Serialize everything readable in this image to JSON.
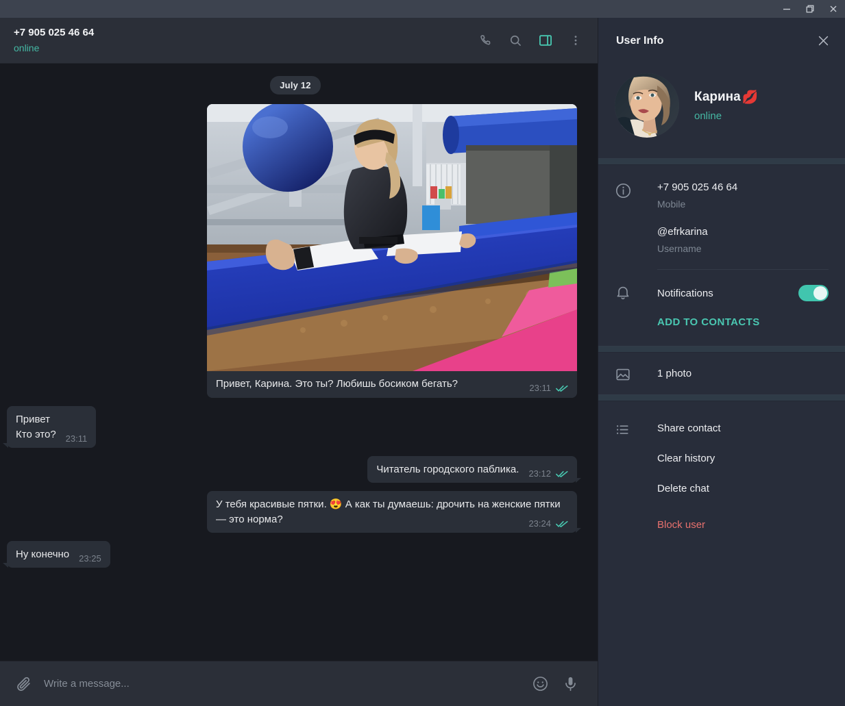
{
  "window": {
    "controls": [
      {
        "name": "minimize",
        "label": "Minimize"
      },
      {
        "name": "restore",
        "label": "Restore"
      },
      {
        "name": "close",
        "label": "Close"
      }
    ]
  },
  "chat_header": {
    "name": "+7 905 025 46 64",
    "status": "online",
    "actions": [
      {
        "icon": "phone-icon",
        "label": "Call"
      },
      {
        "icon": "search-icon",
        "label": "Search"
      },
      {
        "icon": "info-panel-toggle-icon",
        "label": "Toggle info panel",
        "active": true
      },
      {
        "icon": "more-vertical-icon",
        "label": "More"
      }
    ]
  },
  "conversation": {
    "date_separator": "July 12",
    "messages": [
      {
        "id": "m1",
        "direction": "out",
        "type": "photo",
        "photo_alt": "Woman in black jacket and white pants doing side splits on a blue gym mat, blue exercise ball and gym equipment in the background",
        "text": "Привет, Карина. Это ты? Любишь босиком бегать?",
        "time": "23:11",
        "status": "read"
      },
      {
        "id": "m2",
        "direction": "in",
        "type": "text",
        "text": "Привет\nКто это?",
        "time": "23:11",
        "status": ""
      },
      {
        "id": "m3",
        "direction": "out",
        "type": "text",
        "text": "Читатель городского паблика.",
        "time": "23:12",
        "status": "read"
      },
      {
        "id": "m4",
        "direction": "out",
        "type": "text",
        "text": "У тебя красивые пятки. 😍 А как ты думаешь: дрочить на женские пятки — это норма?",
        "time": "23:24",
        "status": "read"
      },
      {
        "id": "m5",
        "direction": "in",
        "type": "text",
        "text": "Ну конечно",
        "time": "23:25",
        "status": ""
      }
    ]
  },
  "composer": {
    "attach_icon": "paperclip-icon",
    "placeholder": "Write a message...",
    "value": "",
    "emoji_icon": "smiley-icon",
    "mic_icon": "microphone-icon"
  },
  "info_panel": {
    "title": "User Info",
    "close_icon": "close-icon",
    "profile": {
      "name": "Карина",
      "name_emoji": "💋",
      "status": "online",
      "avatar_alt": "Portrait selfie of a young woman with light brown hair"
    },
    "contact": {
      "icon": "info-circle-icon",
      "phone_value": "+7 905 025 46 64",
      "phone_label": "Mobile",
      "username_value": "@efrkarina",
      "username_label": "Username"
    },
    "notifications": {
      "icon": "bell-icon",
      "label": "Notifications",
      "enabled": true
    },
    "add_to_contacts": "ADD TO CONTACTS",
    "media": {
      "icon": "photo-icon",
      "label": "1 photo"
    },
    "menu": {
      "icon": "list-icon",
      "items": [
        {
          "label": "Share contact",
          "danger": false
        },
        {
          "label": "Clear history",
          "danger": false
        },
        {
          "label": "Delete chat",
          "danger": false
        },
        {
          "label": "Block user",
          "danger": true
        }
      ]
    }
  },
  "colors": {
    "accent": "#48c7b0",
    "danger": "#e8716e",
    "titlebar": "#3d434f",
    "panel": "#282d3a",
    "chat_bg": "#17191f",
    "bubble": "#2a2f38"
  }
}
